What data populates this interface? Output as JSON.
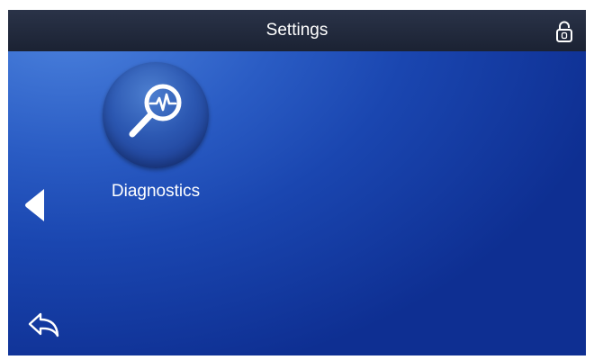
{
  "header": {
    "title": "Settings",
    "lock_icon": "padlock-icon"
  },
  "main": {
    "tiles": [
      {
        "label": "Diagnostics",
        "icon": "magnifier-heartbeat-icon"
      }
    ]
  },
  "navigation": {
    "previous_icon": "left-arrow-icon",
    "back_icon": "back-return-icon"
  },
  "colors": {
    "title_bar": "#1f2639",
    "background_light": "#4f86e0",
    "background_dark": "#0e2f92",
    "tile": "#2c58b2",
    "text": "#ffffff"
  }
}
